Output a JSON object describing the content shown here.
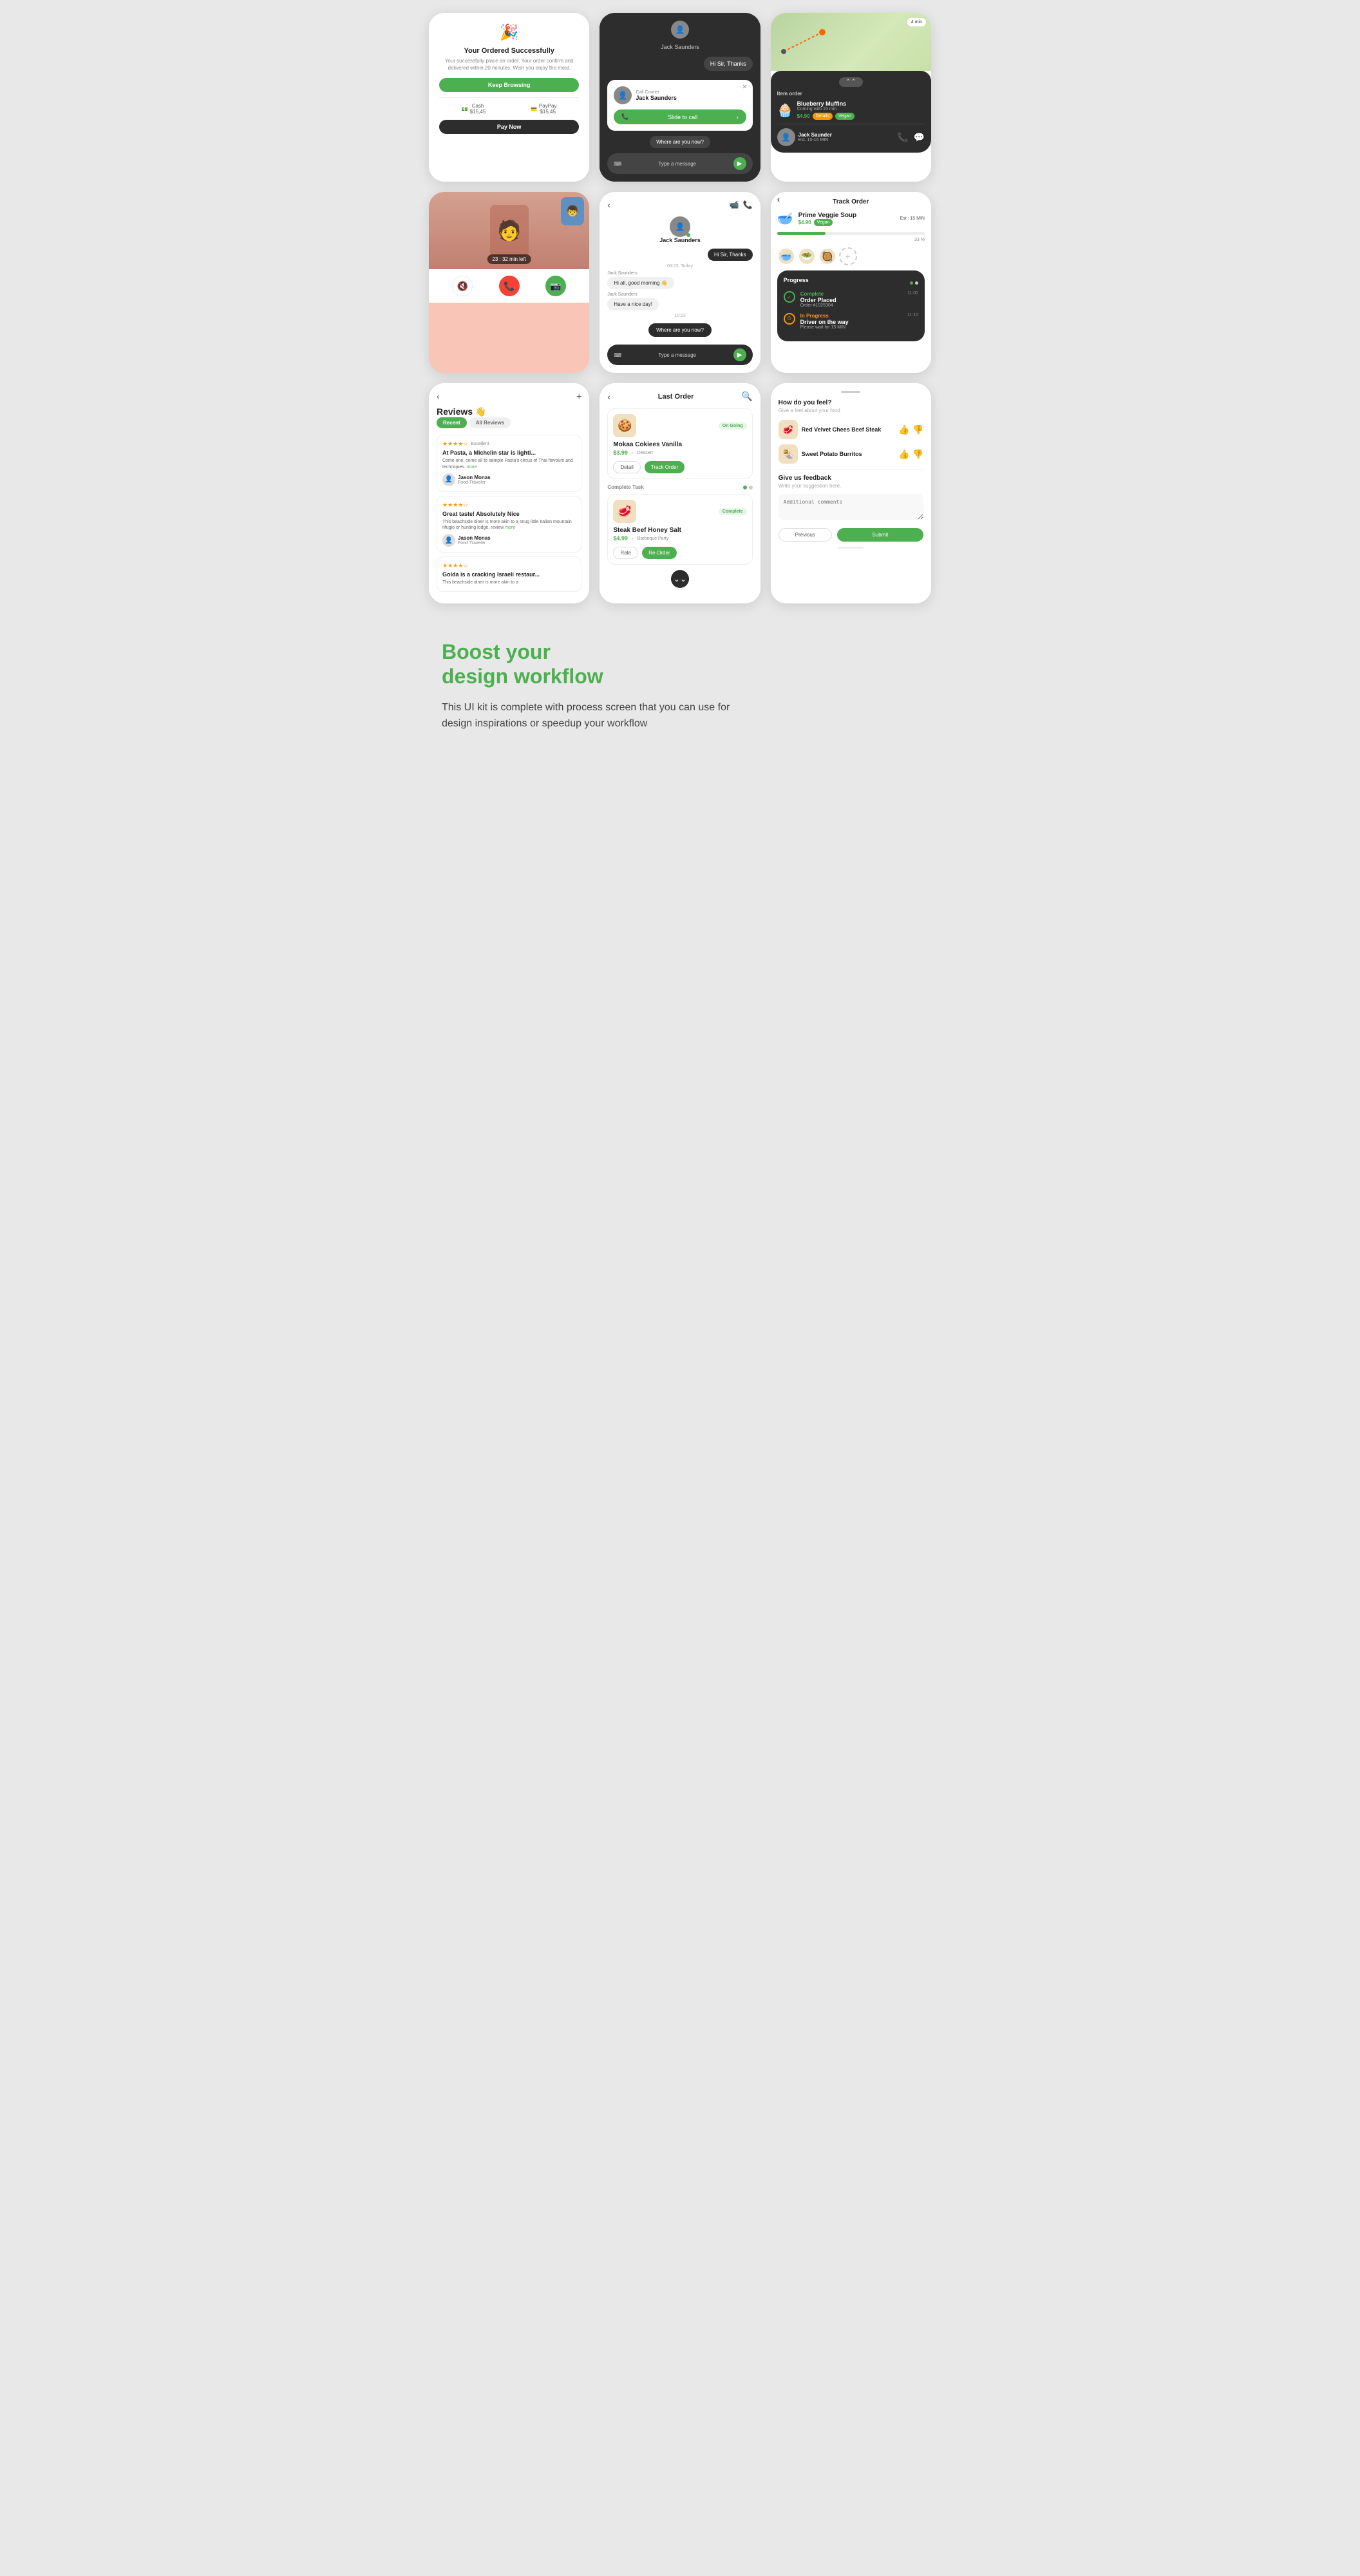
{
  "page": {
    "bg_color": "#e8e8e8"
  },
  "card1": {
    "title": "Your Ordered Successfully",
    "subtitle": "Your successfully place an order. Your order confirm and delivered within 20 minutes. Wish you enjoy the meal.",
    "btn_browse": "Keep Browsing",
    "cash_label": "Cash",
    "cash_amount": "$15,45",
    "paypay_label": "PayPay",
    "paypay_amount": "$15,45",
    "btn_pay": "Pay Now"
  },
  "card2": {
    "name": "Jack Saunders",
    "greeting": "Hi Sir, Thanks",
    "popup_label": "Call Courier",
    "popup_name": "Jack Saunders",
    "slide_label": "Slide to call",
    "where_msg": "Where are you now?",
    "input_placeholder": "Type a message"
  },
  "card3": {
    "item_order": "Item order",
    "item_name": "Blueberry Muffins",
    "item_coming": "Coming with 15 min",
    "item_price": "$4.90",
    "item_tag": "Details",
    "item_vegan": "Vegan",
    "driver_name": "Jack Saunder",
    "driver_eta": "Est. 10-15 MIN"
  },
  "card4": {
    "timer": "23 : 32 min left"
  },
  "card5": {
    "name": "Jack Saunders",
    "greeting": "Hi Sir, Thanks",
    "time1": "09:23, Today",
    "sender": "Jack Saunders",
    "morning_msg": "Hi all, good morning 👋",
    "nice_day": "Have a nice day!",
    "time2": "10:23",
    "where_msg": "Where are you now?",
    "input_placeholder": "Type a message"
  },
  "card6": {
    "title": "Track Order",
    "item_name": "Prime Veggie Soup",
    "item_price": "$4.90",
    "item_tag": "Vegan",
    "est_label": "Est : 15 MIN",
    "progress_pct": "33 %",
    "progress_value": 33,
    "complete_label": "Complete",
    "complete_time": "11:00",
    "order_placed_title": "Order Placed",
    "order_placed_id": "Order #1025304",
    "in_progress_label": "In Progress",
    "in_progress_time": "11:10",
    "driver_title": "Driver on the way",
    "driver_sub": "Please wait for 15 MIN"
  },
  "card7": {
    "title": "Reviews 👋",
    "tab_recent": "Recent",
    "tab_all": "All Reviews",
    "reviews": [
      {
        "stars": 4,
        "label": "Excellent",
        "title": "At Pasta, a Michelin star is lighti...",
        "text": "Come one, come all to sample Pasta's circus of Thai flavours and techniques.",
        "more": "more",
        "reviewer": "Jason Monas",
        "role": "Food Traveler"
      },
      {
        "stars": 4,
        "label": "",
        "title": "Great taste! Absolutely Nice",
        "text": "This beachside diner is more akin to a snug little Italian mountain rifugio or hunting lodge, review",
        "more": "more",
        "reviewer": "Jason Monas",
        "role": "Food Traveler"
      },
      {
        "stars": 4,
        "label": "",
        "title": "Golda is a cracking Israeli restaur...",
        "text": "This beachside diner is more akin to a",
        "more": "",
        "reviewer": "",
        "role": ""
      }
    ]
  },
  "card8": {
    "title": "Last Order",
    "ongoing_label": "On Going",
    "complete_label": "Complete",
    "food1_name": "Mokaa Cokiees Vanilla",
    "food1_price": "$3.99",
    "food1_category": "Dessert",
    "food2_name": "Steak Beef Honey Salt",
    "food2_price": "$4.99",
    "food2_category": "Barbeque Party",
    "btn_detail": "Detail",
    "btn_track": "Track Order",
    "btn_rate": "Rate",
    "btn_reorder": "Re-Order",
    "complete_task_label": "Complete Task"
  },
  "card9": {
    "question": "How do you feel?",
    "subtitle": "Give a feel about your food",
    "food1_name": "Red Velvet Chees Beef Steak",
    "food2_name": "Sweet Potato Burritos",
    "give_feedback_title": "Give us feedback",
    "give_feedback_sub": "Write your suggestion here.",
    "input_placeholder": "Additional comments",
    "btn_previous": "Previous",
    "btn_submit": "Submit"
  },
  "bottom": {
    "title_line1": "Boost your",
    "title_line2": "design workflow",
    "description": "This UI kit is complete with process screen that you can use for design inspirations or speedup your workflow"
  }
}
